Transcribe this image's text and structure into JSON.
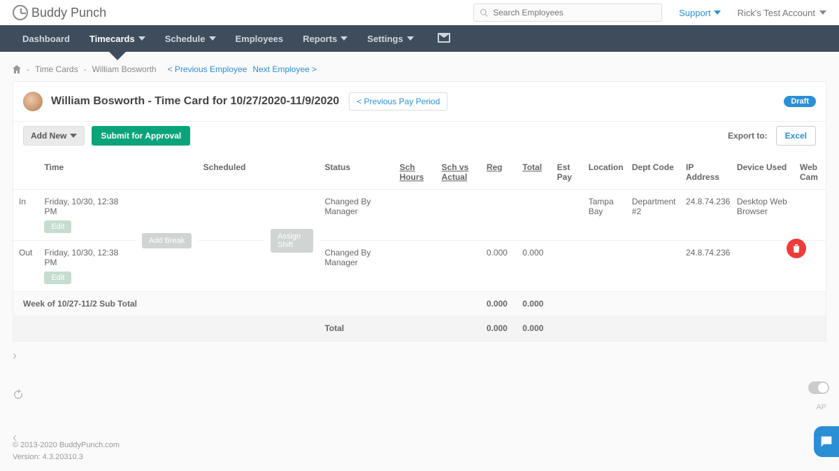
{
  "brand": {
    "part1": "Buddy",
    "part2": "Punch"
  },
  "search": {
    "placeholder": "Search Employees"
  },
  "top_links": {
    "support": "Support",
    "account": "Rick's Test Account"
  },
  "nav": {
    "dashboard": "Dashboard",
    "timecards": "Timecards",
    "schedule": "Schedule",
    "employees": "Employees",
    "reports": "Reports",
    "settings": "Settings"
  },
  "breadcrumb": {
    "sep1": " - ",
    "timecards": "Time Cards",
    "sep2": " - ",
    "employee": "William Bosworth",
    "prev": "< Previous Employee",
    "next": "Next Employee >"
  },
  "card": {
    "title": "William Bosworth - Time Card for 10/27/2020-11/9/2020",
    "prev_period": "< Previous Pay Period",
    "draft": "Draft"
  },
  "toolbar": {
    "add_new": "Add New",
    "submit": "Submit for Approval",
    "export_to": "Export to:",
    "excel": "Excel"
  },
  "columns": {
    "time": "Time",
    "scheduled": "Scheduled",
    "status": "Status",
    "sch_hours": "Sch Hours",
    "sch_vs": "Sch vs Actual",
    "reg": "Reg",
    "total": "Total",
    "est_pay": "Est Pay",
    "location": "Location",
    "dept": "Dept Code",
    "ip": "IP Address",
    "device": "Device Used",
    "cam": "Web Cam"
  },
  "rows": [
    {
      "io": "In",
      "time": "Friday, 10/30, 12:38 PM",
      "edit": "Edit",
      "status": "Changed By Manager",
      "reg": "",
      "total": "",
      "location": "Tampa Bay",
      "dept": "Department #2",
      "ip": "24.8.74.236",
      "device": "Desktop Web Browser"
    },
    {
      "io": "Out",
      "time": "Friday, 10/30, 12:38 PM",
      "edit": "Edit",
      "status": "Changed By Manager",
      "reg": "0.000",
      "total": "0.000",
      "location": "",
      "dept": "",
      "ip": "24.8.74.236",
      "device": ""
    }
  ],
  "middle_buttons": {
    "add_break": "Add Break",
    "assign_shift": "Assign Shift"
  },
  "subtotal": {
    "label": "Week of 10/27-11/2 Sub Total",
    "reg": "0.000",
    "total": "0.000"
  },
  "grandtotal": {
    "label": "Total",
    "reg": "0.000",
    "total": "0.000"
  },
  "footer": {
    "copyright": "© 2013-2020 BuddyPunch.com",
    "version": "Version: 4.3.20310.3"
  },
  "ap": "AP"
}
